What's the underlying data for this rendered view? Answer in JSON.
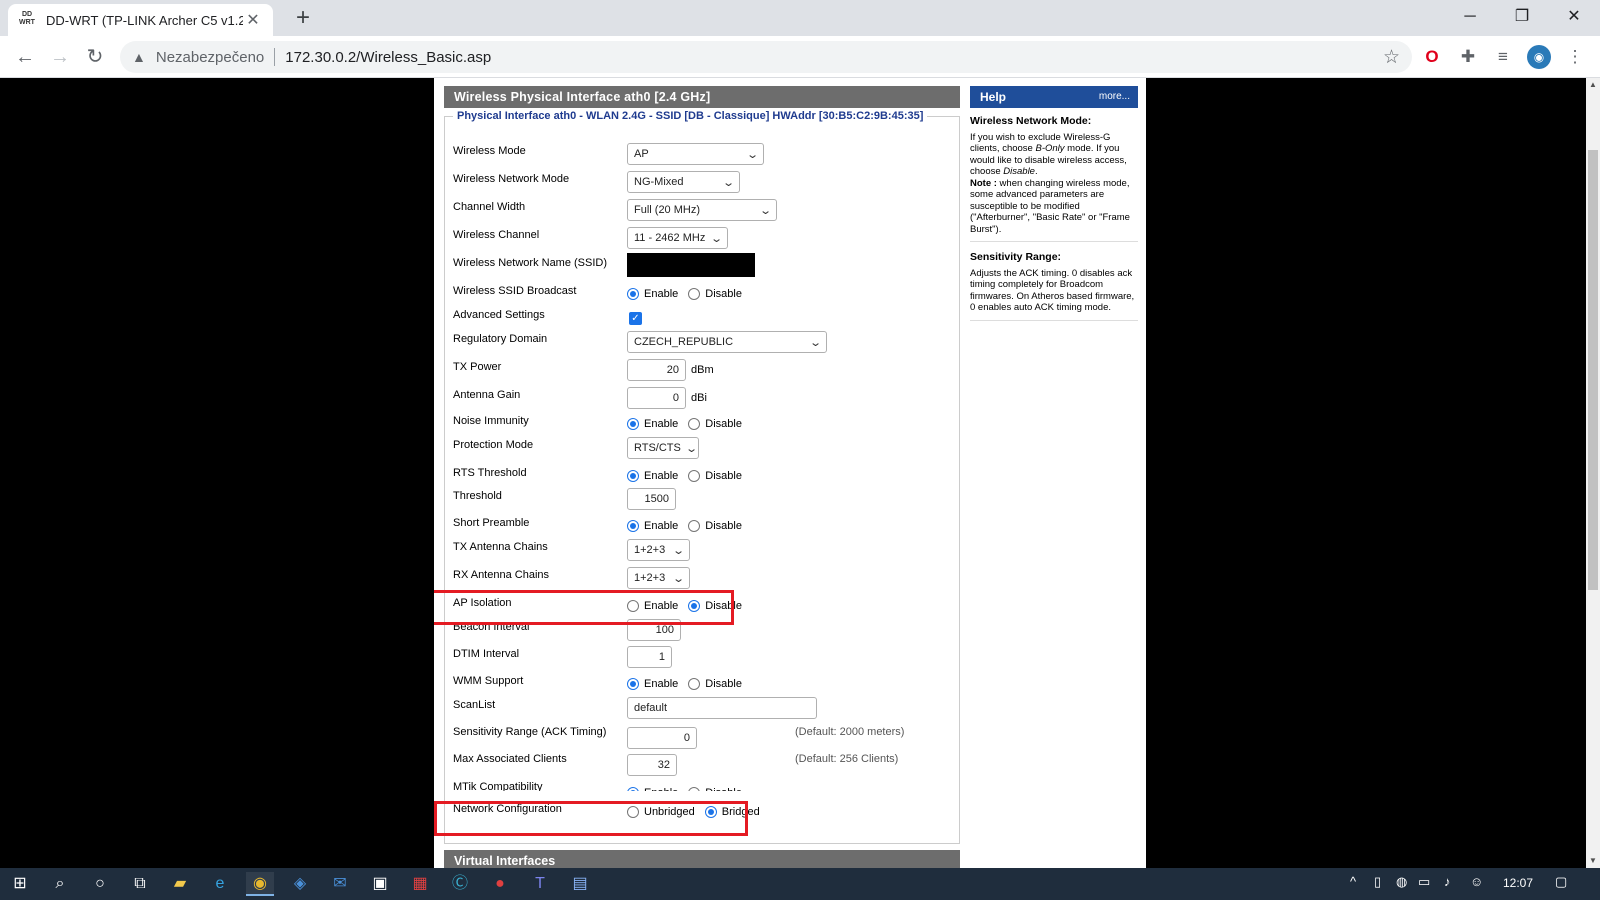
{
  "browser": {
    "tab_title": "DD-WRT (TP-LINK Archer C5 v1.2",
    "favicon_text": "DD WRT",
    "security_label": "Nezabezpečeno",
    "url": "172.30.0.2/Wireless_Basic.asp"
  },
  "panel": {
    "title": "Wireless Physical Interface ath0 [2.4 GHz]",
    "legend": "Physical Interface ath0 - WLAN 2.4G - SSID [DB - Classique] HWAddr [30:B5:C2:9B:45:35]",
    "next_title": "Virtual Interfaces"
  },
  "radio_labels": {
    "enable": "Enable",
    "disable": "Disable",
    "unbridged": "Unbridged",
    "bridged": "Bridged"
  },
  "fields": {
    "wireless_mode": {
      "label": "Wireless Mode",
      "value": "AP"
    },
    "network_mode": {
      "label": "Wireless Network Mode",
      "value": "NG-Mixed"
    },
    "channel_width": {
      "label": "Channel Width",
      "value": "Full (20 MHz)"
    },
    "channel": {
      "label": "Wireless Channel",
      "value": "11 - 2462 MHz"
    },
    "ssid": {
      "label": "Wireless Network Name (SSID)"
    },
    "ssid_broadcast": {
      "label": "Wireless SSID Broadcast",
      "selected": "Enable"
    },
    "advanced": {
      "label": "Advanced Settings",
      "checked": true
    },
    "regdomain": {
      "label": "Regulatory Domain",
      "value": "CZECH_REPUBLIC"
    },
    "tx_power": {
      "label": "TX Power",
      "value": "20",
      "unit": "dBm"
    },
    "antenna_gain": {
      "label": "Antenna Gain",
      "value": "0",
      "unit": "dBi"
    },
    "noise_immunity": {
      "label": "Noise Immunity",
      "selected": "Enable"
    },
    "protection_mode": {
      "label": "Protection Mode",
      "value": "RTS/CTS"
    },
    "rts_threshold": {
      "label": "RTS Threshold",
      "selected": "Enable"
    },
    "threshold": {
      "label": "Threshold",
      "value": "1500"
    },
    "short_preamble": {
      "label": "Short Preamble",
      "selected": "Enable"
    },
    "tx_chains": {
      "label": "TX Antenna Chains",
      "value": "1+2+3"
    },
    "rx_chains": {
      "label": "RX Antenna Chains",
      "value": "1+2+3"
    },
    "ap_isolation": {
      "label": "AP Isolation",
      "selected": "Disable"
    },
    "beacon": {
      "label": "Beacon Interval",
      "value": "100"
    },
    "dtim": {
      "label": "DTIM Interval",
      "value": "1"
    },
    "wmm": {
      "label": "WMM Support",
      "selected": "Enable"
    },
    "scanlist": {
      "label": "ScanList",
      "value": "default"
    },
    "sensitivity": {
      "label": "Sensitivity Range (ACK Timing)",
      "value": "0",
      "note": "(Default: 2000 meters)"
    },
    "max_clients": {
      "label": "Max Associated Clients",
      "value": "32",
      "note": "(Default: 256 Clients)"
    },
    "mtik": {
      "label": "MTik Compatibility",
      "selected": "Enable"
    },
    "network_config": {
      "label": "Network Configuration",
      "selected": "Bridged"
    }
  },
  "help": {
    "title": "Help",
    "more": "more...",
    "s1_title": "Wireless Network Mode:",
    "s1_p1": "If you wish to exclude Wireless-G clients, choose ",
    "s1_p1_em": "B-Only",
    "s1_p2": " mode. If you would like to disable wireless access, choose ",
    "s1_p2_em": "Disable",
    "s1_p3": ".",
    "s1_note_label": "Note :",
    "s1_note": " when changing wireless mode, some advanced parameters are susceptible to be modified (\"Afterburner\", \"Basic Rate\" or \"Frame Burst\").",
    "s2_title": "Sensitivity Range:",
    "s2_body": "Adjusts the ACK timing. 0 disables ack timing completely for Broadcom firmwares. On Atheros based firmware, 0 enables auto ACK timing mode."
  },
  "taskbar": {
    "clock": "12:07"
  },
  "colors": {
    "highlight": "#e41b23",
    "panel_header": "#6d6d6d",
    "help_header": "#1f4e9a",
    "radio_on": "#1a73e8"
  }
}
